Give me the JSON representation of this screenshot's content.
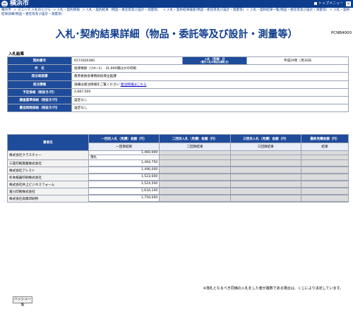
{
  "header": {
    "site_name": "横浜市",
    "top_menu": "トップメニュー",
    "close": "×"
  },
  "breadcrumb": [
    "横浜市",
    "> ヨコハマ 入札のとびら",
    "> 入札・契約情報",
    "> 入札・契約結果（物品・委託等及び設計・測量等）",
    "> 入札・契約結果検索(物品・委託等及び設計・測量等)",
    "> 入札・契約結果一覧(物品・委託等及び設計・測量等)",
    "> 入札・契約結果詳細(物品・委託等及び設計・測量等)"
  ],
  "title": "入札･契約結果詳細（物品・委託等及び設計・測量等）",
  "page_code": "PCNB4000",
  "section_label": "入札結果",
  "info": {
    "contract_no_label": "契約番号",
    "contract_no": "0173020360",
    "bid_date_label": "入札（見積）日",
    "bid_date_sub": "（電子入札の場合は開札日）",
    "bid_date": "平成29年（月30日",
    "subject_label": "件　名",
    "subject": "指導要録（小A−1）　31,900冊ほかの印刷",
    "dept_label": "発注局部課",
    "dept": "教育委員会事務局指導企画課",
    "info_label": "発注情報",
    "info_text": "詳細は発注情報をご覧ください",
    "info_link": "発注情報はこちら",
    "est_label": "予定価格（税抜き/円）",
    "est": "2,687,500",
    "base_label": "調査基準価格（税抜き/円）",
    "base": "設定なし",
    "min_label": "最低制限価格（税抜き/円）",
    "min": "設定なし"
  },
  "bid_table": {
    "headers": [
      "業者名",
      "一回目入札（見積）金額（円）",
      "二回目入札（見積）金額（円）",
      "三回目入札（見積）金額（円）",
      "最終見積金額（円）"
    ],
    "subheaders": [
      "一回目結果",
      "二回目結果",
      "三回目結果",
      "結果"
    ],
    "rows": [
      {
        "name": "株式会社クラスチャー",
        "amount": "1,460,000",
        "result": "落札"
      },
      {
        "name": "三進印刷興業株式会社",
        "amount": "1,494,750",
        "result": ""
      },
      {
        "name": "株式会社アシスト",
        "amount": "1,496,000",
        "result": ""
      },
      {
        "name": "杉本紙器印刷株式会社",
        "amount": "1,523,000",
        "result": ""
      },
      {
        "name": "株式会社井上ビジネスフォーム",
        "amount": "1,524,500",
        "result": ""
      },
      {
        "name": "富川印刷株式会社",
        "amount": "1,634,100",
        "result": ""
      },
      {
        "name": "株式会社高陽印刷所",
        "amount": "1,750,000",
        "result": ""
      }
    ]
  },
  "note": "※落札となるべき同価の入札をした者が複数である場合は、くじにより決定しています。",
  "back_button": "ハッシュ一覧"
}
